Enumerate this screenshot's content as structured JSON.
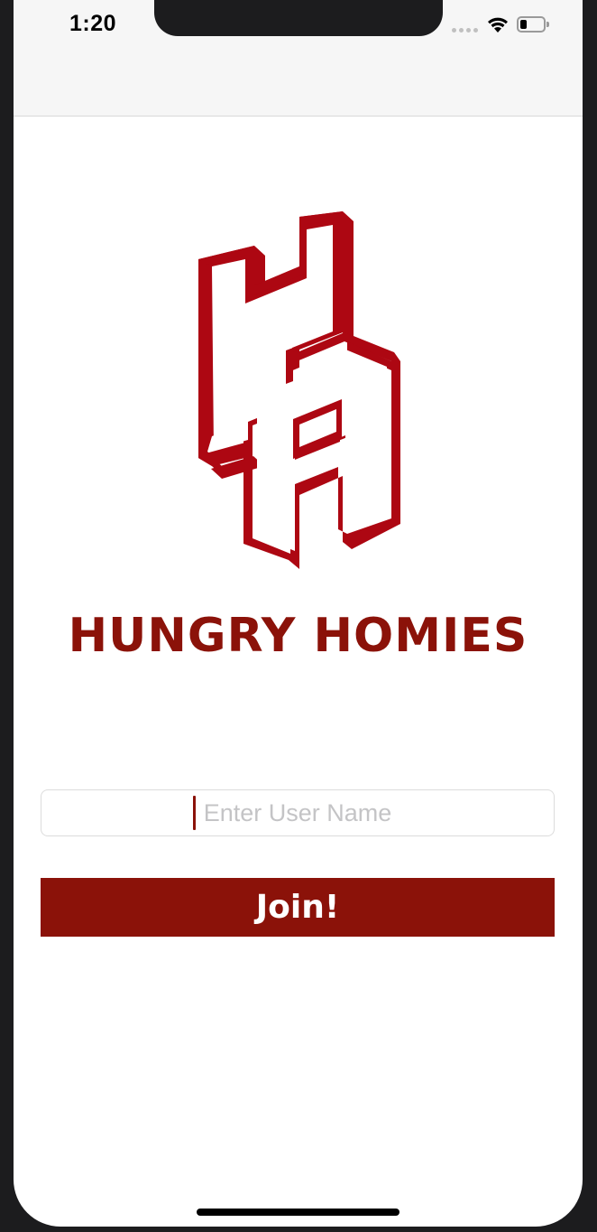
{
  "status_bar": {
    "time": "1:20",
    "icons": [
      "cellular-signal-icon",
      "wifi-icon",
      "battery-icon"
    ],
    "battery_level": 0.3
  },
  "brand": {
    "logo_icon": "hh-monogram-logo",
    "name": "HUNGRY HOMIES",
    "color": "#8b1209",
    "logo_color": "#ad0712"
  },
  "form": {
    "username_placeholder": "Enter User Name",
    "username_value": "",
    "join_label": "Join!"
  },
  "colors": {
    "accent": "#8b1209",
    "background": "#ffffff",
    "bar_background": "#f6f6f6"
  }
}
